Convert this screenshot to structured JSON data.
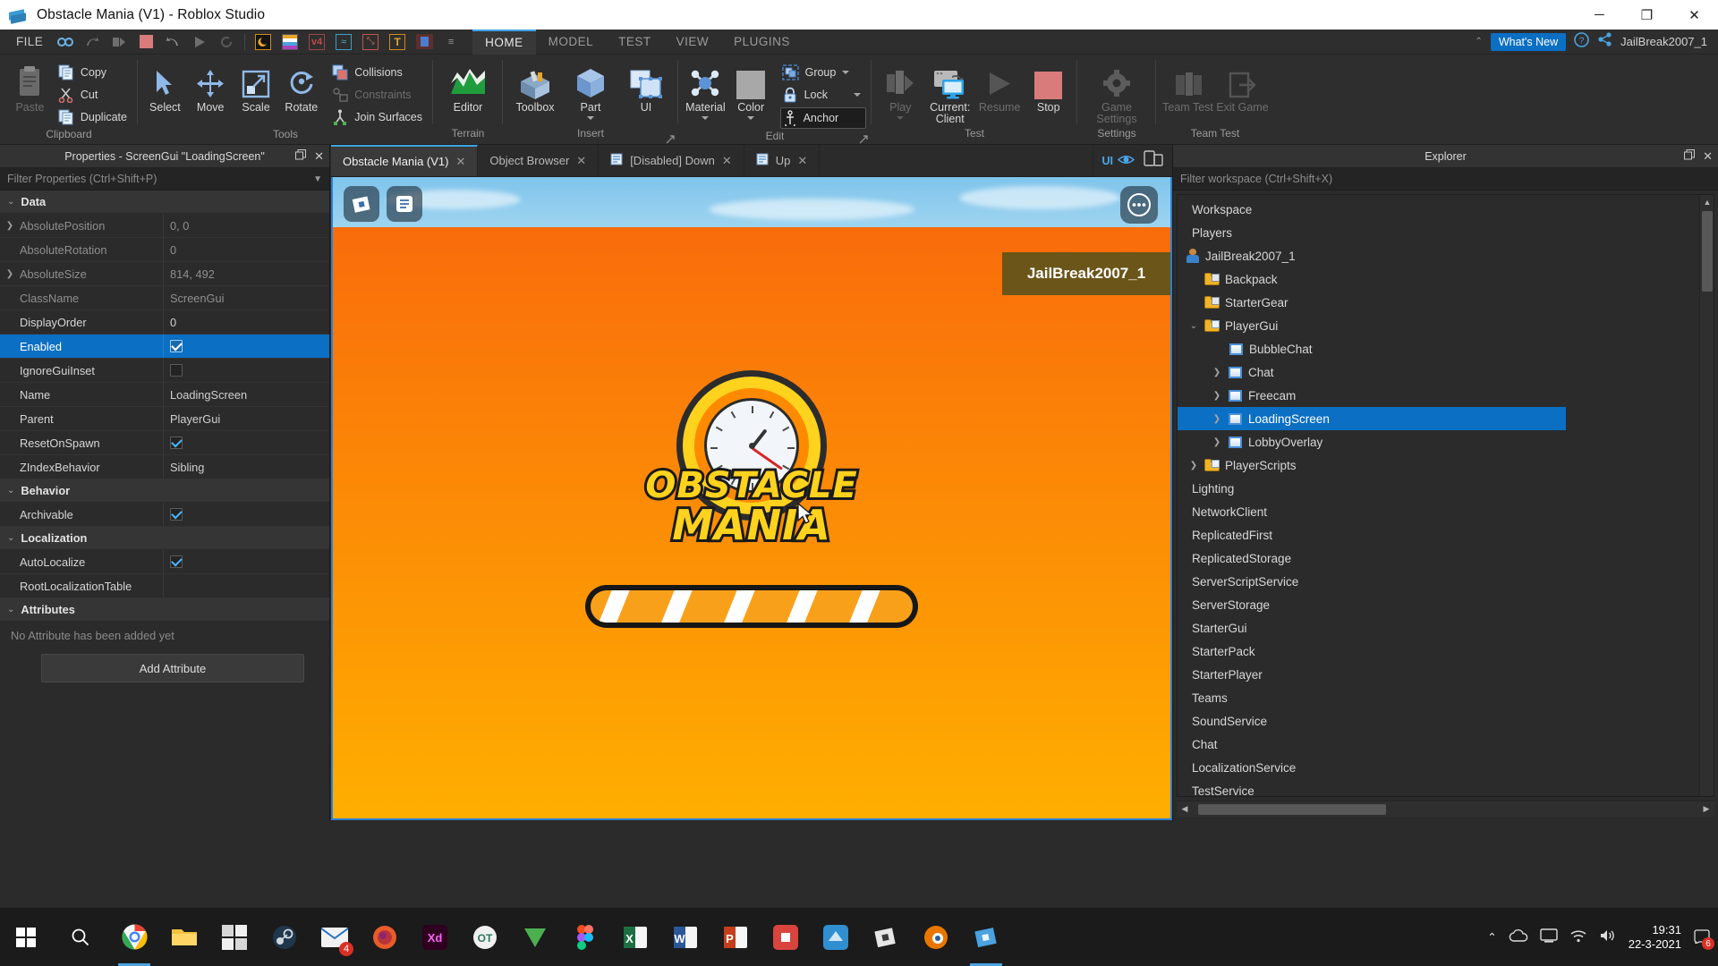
{
  "window": {
    "title": "Obstacle Mania (V1) - Roblox Studio",
    "minimize": "─",
    "maximize": "❐",
    "close": "✕"
  },
  "quick_access": {
    "file_label": "FILE",
    "icons": [
      "find-icon",
      "redo-icon",
      "next-icon",
      "stop-square-icon",
      "undo-icon",
      "play-icon",
      "reset-icon",
      "night-mode-icon",
      "rainbow-icon",
      "v4-icon",
      "wave-icon",
      "resize-icon",
      "text-icon",
      "avatar-icon"
    ],
    "overflow": "≡"
  },
  "ribbon_tabs": [
    {
      "label": "HOME",
      "active": true
    },
    {
      "label": "MODEL",
      "active": false
    },
    {
      "label": "TEST",
      "active": false
    },
    {
      "label": "VIEW",
      "active": false
    },
    {
      "label": "PLUGINS",
      "active": false
    }
  ],
  "account_bar": {
    "whats_new": "What's New",
    "help_icon": "question-icon",
    "share_icon": "share-icon",
    "username": "JailBreak2007_1"
  },
  "ribbon_groups": [
    {
      "name": "Clipboard",
      "big": [
        {
          "label": "Paste",
          "icon": "paste-icon",
          "enabled": false
        }
      ],
      "small": [
        {
          "label": "Copy",
          "icon": "copy-icon",
          "enabled": true
        },
        {
          "label": "Cut",
          "icon": "cut-icon",
          "enabled": true
        },
        {
          "label": "Duplicate",
          "icon": "duplicate-icon",
          "enabled": true
        }
      ]
    },
    {
      "name": "Tools",
      "big": [
        {
          "label": "Select",
          "icon": "arrow-cursor-icon",
          "enabled": true
        },
        {
          "label": "Move",
          "icon": "move-icon",
          "enabled": true
        },
        {
          "label": "Scale",
          "icon": "scale-icon",
          "enabled": true
        },
        {
          "label": "Rotate",
          "icon": "rotate-icon",
          "enabled": true
        }
      ],
      "small": [
        {
          "label": "Collisions",
          "icon": "collisions-icon",
          "enabled": true
        },
        {
          "label": "Constraints",
          "icon": "constraints-icon",
          "enabled": false
        },
        {
          "label": "Join Surfaces",
          "icon": "join-surfaces-icon",
          "enabled": true
        }
      ]
    },
    {
      "name": "Terrain",
      "big": [
        {
          "label": "Editor",
          "icon": "terrain-editor-icon",
          "enabled": true
        }
      ],
      "small": []
    },
    {
      "name": "Insert",
      "big": [
        {
          "label": "Toolbox",
          "icon": "toolbox-icon",
          "enabled": true
        },
        {
          "label": "Part",
          "icon": "part-cube-icon",
          "enabled": true,
          "dropdown": true
        },
        {
          "label": "UI",
          "icon": "ui-icon",
          "enabled": true
        }
      ],
      "small": []
    },
    {
      "name": "Edit",
      "big": [
        {
          "label": "Material",
          "icon": "material-icon",
          "enabled": true,
          "dropdown": true
        },
        {
          "label": "Color",
          "icon": "color-swatch-icon",
          "enabled": true,
          "dropdown": true
        }
      ],
      "small": [
        {
          "label": "Group",
          "icon": "group-icon",
          "enabled": true,
          "dropdown": true
        },
        {
          "label": "Lock",
          "icon": "lock-icon",
          "enabled": true,
          "dropdown": true
        },
        {
          "label": "Anchor",
          "icon": "anchor-icon",
          "enabled": true,
          "highlighted": true
        }
      ]
    },
    {
      "name": "Test",
      "big": [
        {
          "label": "Play",
          "icon": "play-avatar-icon",
          "enabled": false,
          "dropdown": true
        },
        {
          "label": "Current: Client",
          "icon": "current-client-icon",
          "enabled": true
        },
        {
          "label": "Resume",
          "icon": "resume-icon",
          "enabled": false
        },
        {
          "label": "Stop",
          "icon": "stop-icon",
          "enabled": true
        }
      ],
      "small": []
    },
    {
      "name": "Settings",
      "big": [
        {
          "label": "Game Settings",
          "icon": "gear-icon",
          "enabled": false
        }
      ],
      "small": []
    },
    {
      "name": "Team Test",
      "big": [
        {
          "label": "Team Test",
          "icon": "team-test-icon",
          "enabled": false
        },
        {
          "label": "Exit Game",
          "icon": "exit-game-icon",
          "enabled": false
        }
      ],
      "small": []
    }
  ],
  "properties": {
    "panel_title": "Properties - ScreenGui \"LoadingScreen\"",
    "filter_placeholder": "Filter Properties (Ctrl+Shift+P)",
    "popout_icon": "popout-icon",
    "close_icon": "close-icon",
    "sections": [
      {
        "name": "Data",
        "rows": [
          {
            "key": "AbsolutePosition",
            "value": "0, 0",
            "type": "text",
            "readonly": true,
            "expandable": true
          },
          {
            "key": "AbsoluteRotation",
            "value": "0",
            "type": "text",
            "readonly": true,
            "expandable": false
          },
          {
            "key": "AbsoluteSize",
            "value": "814, 492",
            "type": "text",
            "readonly": true,
            "expandable": true
          },
          {
            "key": "ClassName",
            "value": "ScreenGui",
            "type": "text",
            "readonly": true,
            "expandable": false
          },
          {
            "key": "DisplayOrder",
            "value": "0",
            "type": "text",
            "readonly": false,
            "expandable": false
          },
          {
            "key": "Enabled",
            "value": true,
            "type": "checkbox",
            "readonly": false,
            "expandable": false,
            "selected": true
          },
          {
            "key": "IgnoreGuiInset",
            "value": false,
            "type": "checkbox",
            "readonly": false,
            "expandable": false
          },
          {
            "key": "Name",
            "value": "LoadingScreen",
            "type": "text",
            "readonly": false,
            "expandable": false
          },
          {
            "key": "Parent",
            "value": "PlayerGui",
            "type": "text",
            "readonly": false,
            "expandable": false
          },
          {
            "key": "ResetOnSpawn",
            "value": true,
            "type": "checkbox",
            "readonly": false,
            "expandable": false
          },
          {
            "key": "ZIndexBehavior",
            "value": "Sibling",
            "type": "text",
            "readonly": false,
            "expandable": false
          }
        ]
      },
      {
        "name": "Behavior",
        "rows": [
          {
            "key": "Archivable",
            "value": true,
            "type": "checkbox",
            "readonly": false,
            "expandable": false
          }
        ]
      },
      {
        "name": "Localization",
        "rows": [
          {
            "key": "AutoLocalize",
            "value": true,
            "type": "checkbox",
            "readonly": false,
            "expandable": false
          },
          {
            "key": "RootLocalizationTable",
            "value": "",
            "type": "text",
            "readonly": false,
            "expandable": false
          }
        ]
      },
      {
        "name": "Attributes",
        "rows": []
      }
    ],
    "no_attributes_text": "No Attribute has been added yet",
    "add_attribute_label": "Add Attribute"
  },
  "viewport": {
    "tabs": [
      {
        "label": "Obstacle Mania (V1)",
        "active": true,
        "closable": true,
        "icon": null
      },
      {
        "label": "Object Browser",
        "active": false,
        "closable": true,
        "icon": null
      },
      {
        "label": "[Disabled] Down",
        "active": false,
        "closable": true,
        "icon": "script-icon"
      },
      {
        "label": "Up",
        "active": false,
        "closable": true,
        "icon": "script-icon"
      }
    ],
    "ui_toggle_label": "UI",
    "ui_toggle_icon": "eye-icon",
    "device_emulate_icon": "device-emulate-icon",
    "topleft_buttons": [
      "roblox-logo-icon",
      "menu-list-icon"
    ],
    "more_button_icon": "ellipsis-icon",
    "player_nametag": "JailBreak2007_1",
    "game_logo": {
      "line1": "OBSTACLE",
      "line2": "MANIA",
      "clock_icon": "clock-icon"
    },
    "loading_bar": {
      "progress_percent": 100,
      "stripe_count": 5,
      "fill_color": "#f9a01b"
    },
    "cursor_icon": "mouse-pointer-icon"
  },
  "explorer": {
    "panel_title": "Explorer",
    "filter_placeholder": "Filter workspace (Ctrl+Shift+X)",
    "popout_icon": "popout-icon",
    "close_icon": "close-icon",
    "items": [
      {
        "label": "Workspace",
        "depth": 0,
        "icon": null,
        "twisty": "",
        "selected": false
      },
      {
        "label": "Players",
        "depth": 0,
        "icon": null,
        "twisty": "",
        "selected": false
      },
      {
        "label": "JailBreak2007_1",
        "depth": 0,
        "icon": "player-icon",
        "twisty": "",
        "selected": false
      },
      {
        "label": "Backpack",
        "depth": 1,
        "icon": "folder-script-icon",
        "twisty": "",
        "selected": false
      },
      {
        "label": "StarterGear",
        "depth": 1,
        "icon": "folder-script-icon",
        "twisty": "",
        "selected": false
      },
      {
        "label": "PlayerGui",
        "depth": 1,
        "icon": "folder-gui-icon",
        "twisty": "expanded",
        "selected": false
      },
      {
        "label": "BubbleChat",
        "depth": 2,
        "icon": "screengui-icon",
        "twisty": "",
        "selected": false
      },
      {
        "label": "Chat",
        "depth": 2,
        "icon": "screengui-icon",
        "twisty": "collapsed",
        "selected": false
      },
      {
        "label": "Freecam",
        "depth": 2,
        "icon": "screengui-icon",
        "twisty": "collapsed",
        "selected": false
      },
      {
        "label": "LoadingScreen",
        "depth": 2,
        "icon": "screengui-icon",
        "twisty": "collapsed",
        "selected": true
      },
      {
        "label": "LobbyOverlay",
        "depth": 2,
        "icon": "screengui-icon",
        "twisty": "collapsed",
        "selected": false
      },
      {
        "label": "PlayerScripts",
        "depth": 1,
        "icon": "folder-script-icon",
        "twisty": "collapsed",
        "selected": false
      },
      {
        "label": "Lighting",
        "depth": 0,
        "icon": null,
        "twisty": "",
        "selected": false
      },
      {
        "label": "NetworkClient",
        "depth": 0,
        "icon": null,
        "twisty": "",
        "selected": false
      },
      {
        "label": "ReplicatedFirst",
        "depth": 0,
        "icon": null,
        "twisty": "",
        "selected": false
      },
      {
        "label": "ReplicatedStorage",
        "depth": 0,
        "icon": null,
        "twisty": "",
        "selected": false
      },
      {
        "label": "ServerScriptService",
        "depth": 0,
        "icon": null,
        "twisty": "",
        "selected": false
      },
      {
        "label": "ServerStorage",
        "depth": 0,
        "icon": null,
        "twisty": "",
        "selected": false
      },
      {
        "label": "StarterGui",
        "depth": 0,
        "icon": null,
        "twisty": "",
        "selected": false
      },
      {
        "label": "StarterPack",
        "depth": 0,
        "icon": null,
        "twisty": "",
        "selected": false
      },
      {
        "label": "StarterPlayer",
        "depth": 0,
        "icon": null,
        "twisty": "",
        "selected": false
      },
      {
        "label": "Teams",
        "depth": 0,
        "icon": null,
        "twisty": "",
        "selected": false
      },
      {
        "label": "SoundService",
        "depth": 0,
        "icon": null,
        "twisty": "",
        "selected": false
      },
      {
        "label": "Chat",
        "depth": 0,
        "icon": null,
        "twisty": "",
        "selected": false
      },
      {
        "label": "LocalizationService",
        "depth": 0,
        "icon": null,
        "twisty": "",
        "selected": false
      },
      {
        "label": "TestService",
        "depth": 0,
        "icon": null,
        "twisty": "",
        "selected": false
      }
    ]
  },
  "taskbar": {
    "start_icon": "windows-start-icon",
    "search_icon": "search-icon",
    "apps": [
      {
        "name": "chrome-icon",
        "active": true,
        "badge": null
      },
      {
        "name": "file-explorer-icon",
        "active": false,
        "badge": null
      },
      {
        "name": "microsoft-store-icon",
        "active": false,
        "badge": null
      },
      {
        "name": "steam-icon",
        "active": false,
        "badge": null
      },
      {
        "name": "mail-icon",
        "active": false,
        "badge": "4"
      },
      {
        "name": "firefox-icon",
        "active": false,
        "badge": null
      },
      {
        "name": "adobe-xd-icon",
        "active": false,
        "badge": null
      },
      {
        "name": "obs-icon",
        "active": false,
        "badge": null
      },
      {
        "name": "utorrent-icon",
        "active": false,
        "badge": null
      },
      {
        "name": "figma-icon",
        "active": false,
        "badge": null
      },
      {
        "name": "excel-icon",
        "active": false,
        "badge": null
      },
      {
        "name": "word-icon",
        "active": false,
        "badge": null
      },
      {
        "name": "powerpoint-icon",
        "active": false,
        "badge": null
      },
      {
        "name": "red-app-icon",
        "active": false,
        "badge": null
      },
      {
        "name": "blue-app-icon",
        "active": false,
        "badge": null
      },
      {
        "name": "roblox-player-icon",
        "active": false,
        "badge": null
      },
      {
        "name": "blender-icon",
        "active": false,
        "badge": null
      },
      {
        "name": "roblox-studio-icon",
        "active": true,
        "badge": null
      }
    ],
    "tray": {
      "show_hidden_icon": "chevron-up-icon",
      "onedrive_icon": "cloud-icon",
      "display_icon": "monitor-icon",
      "network_icon": "wifi-icon",
      "volume_icon": "speaker-icon",
      "time": "19:31",
      "date": "22-3-2021",
      "notifications_icon": "notification-icon",
      "notification_count": "6"
    }
  }
}
